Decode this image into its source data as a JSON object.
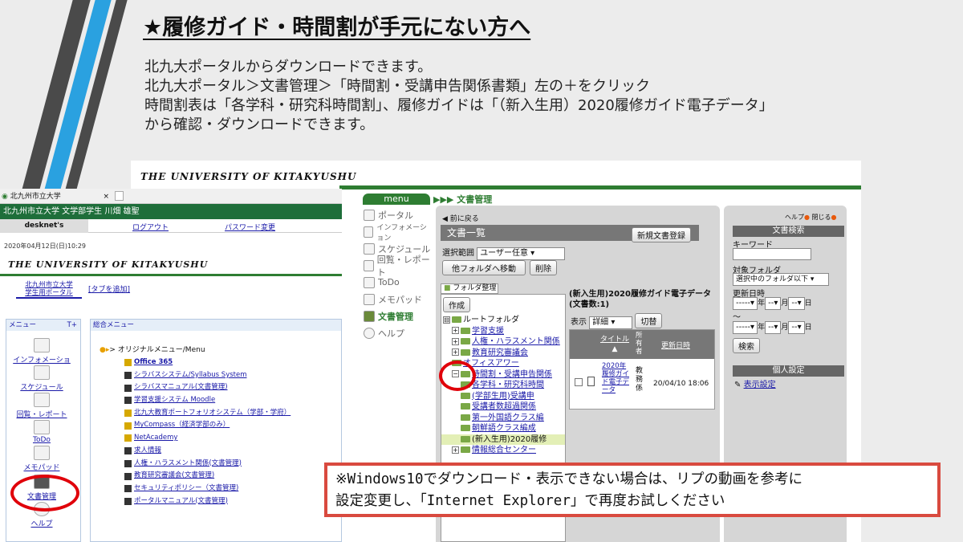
{
  "slide": {
    "title": "★履修ガイド・時間割が手元にない方へ",
    "intro": [
      "北九大ポータルからダウンロードできます。",
      "北九大ポータル＞文書管理＞「時間割・受講申告関係書類」左の＋をクリック",
      "時間割表は「各学科・研究科時間割」、履修ガイドは「（新入生用）2020履修ガイド電子データ」",
      "から確認・ダウンロードできます。"
    ],
    "note": [
      "※Windows10でダウンロード・表示できない場合は、リプの動画を参考に",
      "設定変更し、「Internet Explorer」で再度お試しください"
    ]
  },
  "banner": {
    "title": "THE UNIVERSITY OF KITAKYUSHU"
  },
  "left_portal": {
    "browser_tab": "北九州市立大学",
    "user_bar": "北九州市立大学 文学部学生 川畑 雄聖",
    "nav": {
      "brand": "desknet's",
      "logout": "ログアウト",
      "password": "パスワード変更"
    },
    "datetime": "2020年04月12日(日)10:29",
    "logo": "THE UNIVERSITY OF KITAKYUSHU",
    "portal_tab": [
      "北九州市立大学",
      "学生用ポータル"
    ],
    "add_tab": "[タブを追加]",
    "menu_header": "メニュー",
    "menu_plus": "T+",
    "menu_items": [
      "インフォメーション",
      "スケジュール",
      "回覧・レポート",
      "ToDo",
      "メモパッド",
      "文書管理",
      "ヘルプ"
    ],
    "general_header": "総合メニュー",
    "original_menu": "> オリジナルメニュー/Menu",
    "links": [
      {
        "label": "Office 365",
        "bold": true,
        "icon": "y"
      },
      {
        "label": "シラバスシステム/Syllabus System",
        "icon": "b"
      },
      {
        "label": "シラバスマニュアル(文書管理)",
        "icon": "b"
      },
      {
        "label": "学習支援システム Moodle",
        "icon": "b"
      },
      {
        "label": "北九大教育ポートフォリオシステム（学部・学府）",
        "icon": "y"
      },
      {
        "label": "MyCompass（経済学部のみ）",
        "icon": "y"
      },
      {
        "label": "NetAcademy",
        "icon": "y"
      },
      {
        "label": "求人情報",
        "icon": "b"
      },
      {
        "label": "人権・ハラスメント関係(文書管理)",
        "icon": "b"
      },
      {
        "label": "教育研究審議会(文書管理)",
        "icon": "b"
      },
      {
        "label": "セキュリティポリシー（文書管理)",
        "icon": "b"
      },
      {
        "label": "ポータルマニュアル(文書管理)",
        "icon": "b"
      }
    ]
  },
  "docs_app": {
    "menu_label": "menu",
    "breadcrumb": "▶▶▶ 文書管理",
    "side_menu": [
      "ポータル",
      "インフォメーション",
      "スケジュール",
      "回覧・レポート",
      "ToDo",
      "メモパッド",
      "文書管理",
      "ヘルプ"
    ],
    "back": "前に戻る",
    "list_title": "文書一覧",
    "new_doc": "新規文書登録",
    "scope_label": "選択範囲",
    "scope_value": "ユーザー任意",
    "move_btn": "他フォルダへ移動",
    "delete_btn": "削除",
    "folder_tab": "フォルダ整理",
    "create_btn": "作成",
    "tree": [
      {
        "label": "ルートフォルダ",
        "level": 0,
        "pm": "⊟"
      },
      {
        "label": "学習支援",
        "level": 1,
        "pm": "+",
        "link": true
      },
      {
        "label": "人権・ハラスメント関係",
        "level": 1,
        "pm": "+",
        "link": true
      },
      {
        "label": "教育研究審議会",
        "level": 1,
        "pm": "+",
        "link": true
      },
      {
        "label": "オフィスアワー",
        "level": 1,
        "pm": "",
        "link": true
      },
      {
        "label": "時間割・受講申告関係",
        "level": 1,
        "pm": "−",
        "link": true
      },
      {
        "label": "各学科・研究科時間",
        "level": 2,
        "pm": "",
        "link": true
      },
      {
        "label": "(学部生用)受講申",
        "level": 2,
        "pm": "",
        "link": true
      },
      {
        "label": "受講者数超過関係",
        "level": 2,
        "pm": "",
        "link": true
      },
      {
        "label": "第一外国語クラス編",
        "level": 2,
        "pm": "",
        "link": true
      },
      {
        "label": "朝鮮語クラス編成",
        "level": 2,
        "pm": "",
        "link": true
      },
      {
        "label": "(新入生用)2020履修",
        "level": 2,
        "pm": "",
        "link": false,
        "hl": true
      },
      {
        "label": "情報総合センター",
        "level": 1,
        "pm": "+",
        "link": true
      }
    ],
    "folder_title": "(新入生用)2020履修ガイド電子データ(文書数:1)",
    "display_label": "表示",
    "display_value": "詳細",
    "switch_btn": "切替",
    "table_headers": {
      "title": "タイトル",
      "title_sort": "▲",
      "owner": "所有者",
      "updated": "更新日時"
    },
    "row": {
      "title": "2020年履修ガイド電子データ",
      "owner": "教務係",
      "updated": "20/04/10 18:06"
    }
  },
  "search_panel": {
    "help": "ヘルプ",
    "close": "閉じる",
    "title": "文書検索",
    "keyword_label": "キーワード",
    "folder_label": "対象フォルダ",
    "folder_value": "選択中のフォルダ以下",
    "updated_label": "更新日時",
    "dash4": "-----",
    "dash2": "--",
    "year": "年",
    "month": "月",
    "day": "日",
    "tilde": "〜",
    "search_btn": "検索",
    "personal_title": "個人設定",
    "display_settings": "表示設定"
  }
}
